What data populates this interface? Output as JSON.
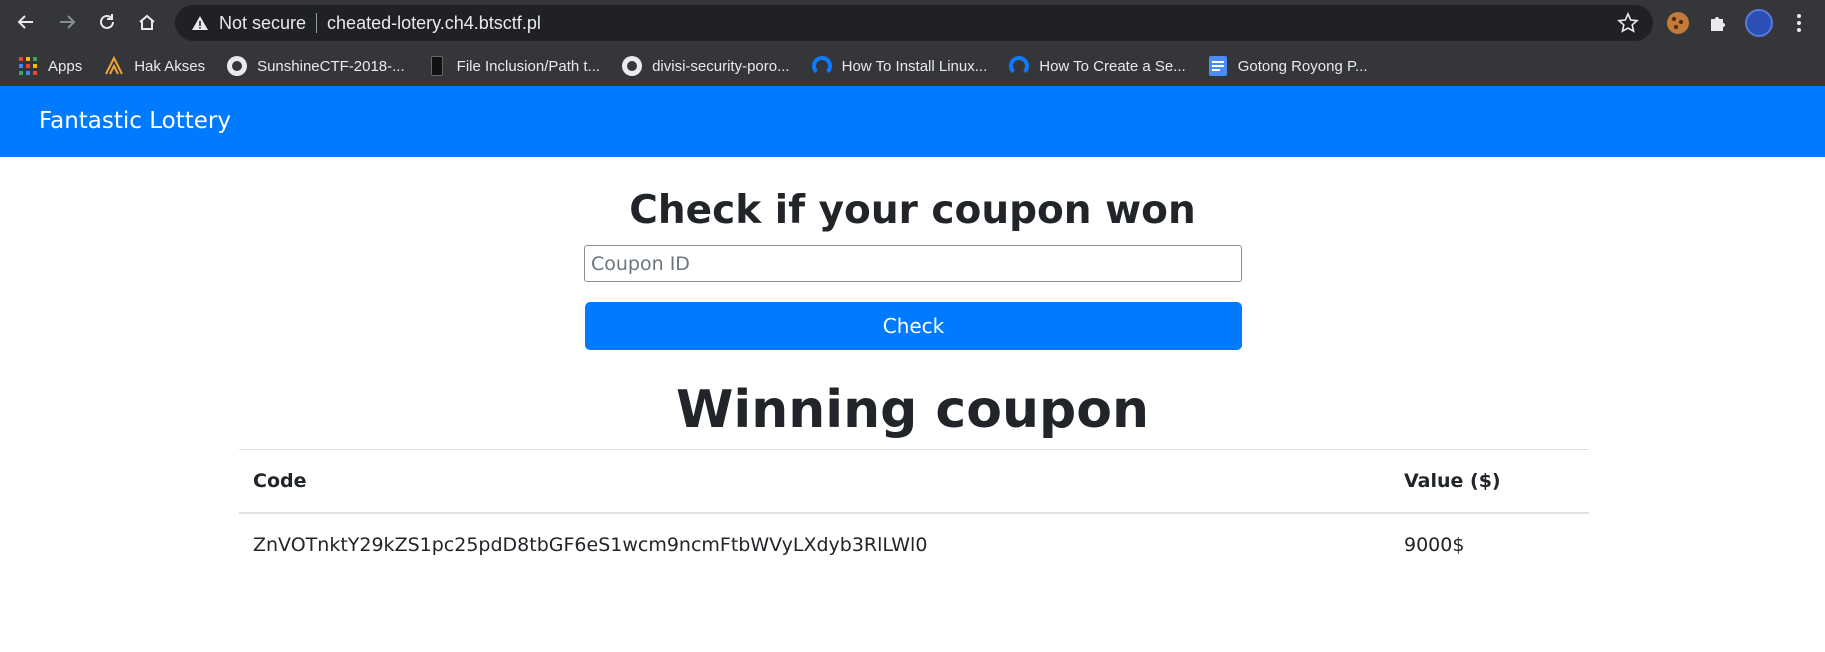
{
  "browser": {
    "security_label": "Not secure",
    "url": "cheated-lotery.ch4.btsctf.pl",
    "bookmarks": [
      {
        "label": "Apps",
        "icon": "apps-grid-icon"
      },
      {
        "label": "Hak Akses",
        "icon": "hak-akses-icon"
      },
      {
        "label": "SunshineCTF-2018-...",
        "icon": "github-icon"
      },
      {
        "label": "File Inclusion/Path t...",
        "icon": "phone-icon"
      },
      {
        "label": "divisi-security-poro...",
        "icon": "github-icon"
      },
      {
        "label": "How To Install Linux...",
        "icon": "digitalocean-icon"
      },
      {
        "label": "How To Create a Se...",
        "icon": "digitalocean-icon"
      },
      {
        "label": "Gotong Royong P...",
        "icon": "google-docs-icon"
      }
    ]
  },
  "navbar": {
    "brand": "Fantastic Lottery"
  },
  "check_form": {
    "title": "Check if your coupon won",
    "input_placeholder": "Coupon ID",
    "input_value": "",
    "button_label": "Check"
  },
  "winning": {
    "title": "Winning coupon",
    "columns": [
      "Code",
      "Value ($)"
    ],
    "rows": [
      {
        "code": "ZnVOTnktY29kZS1pc25pdD8tbGF6eS1wcm9ncmFtbWVyLXdyb3RlLWl0",
        "value": "9000$"
      }
    ]
  },
  "colors": {
    "primary": "#007bff",
    "chrome_bg": "#35363a",
    "text": "#212529"
  }
}
